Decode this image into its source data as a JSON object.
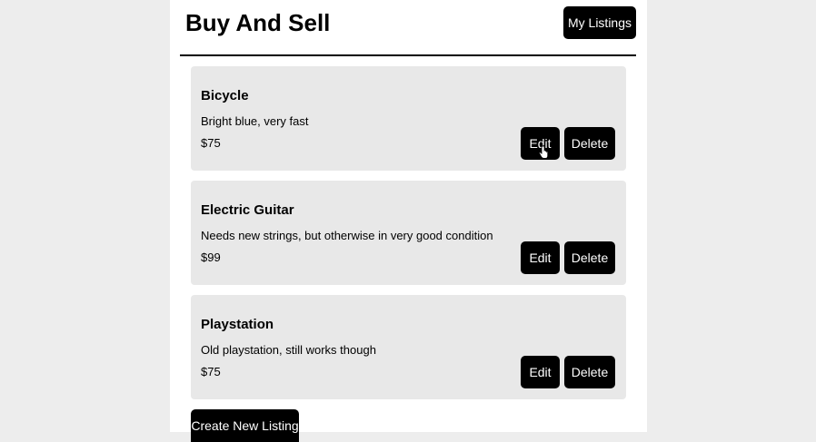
{
  "header": {
    "title": "Buy And Sell",
    "my_listings_label": "My Listings"
  },
  "listings": [
    {
      "title": "Bicycle",
      "description": "Bright blue, very fast",
      "price": "$75",
      "edit_label": "Edit",
      "delete_label": "Delete"
    },
    {
      "title": "Electric Guitar",
      "description": "Needs new strings, but otherwise in very good condition",
      "price": "$99",
      "edit_label": "Edit",
      "delete_label": "Delete"
    },
    {
      "title": "Playstation",
      "description": "Old playstation, still works though",
      "price": "$75",
      "edit_label": "Edit",
      "delete_label": "Delete"
    }
  ],
  "footer": {
    "create_label": "Create New Listing"
  },
  "colors": {
    "background": "#ededed",
    "card": "#e8e8e8",
    "button": "#000000",
    "button_text": "#ffffff"
  },
  "icons": {
    "cursor": "hand-pointer-icon"
  }
}
